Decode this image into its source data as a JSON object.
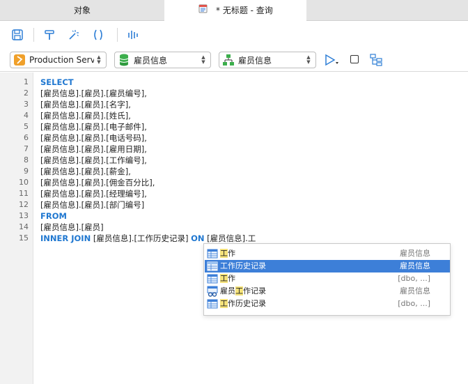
{
  "tabs": {
    "objects": "对象",
    "query": "* 无标题 - 查询"
  },
  "connection": {
    "server": "Production Server",
    "database": "雇员信息",
    "schema": "雇员信息"
  },
  "editor": {
    "line_numbers": [
      "1",
      "2",
      "3",
      "4",
      "5",
      "6",
      "7",
      "8",
      "9",
      "10",
      "11",
      "12",
      "13",
      "14",
      "15"
    ],
    "lines": {
      "l1_kw": "SELECT",
      "l2": "[雇员信息].[雇员].[雇员编号],",
      "l3": "[雇员信息].[雇员].[名字],",
      "l4": "[雇员信息].[雇员].[姓氏],",
      "l5": "[雇员信息].[雇员].[电子邮件],",
      "l6": "[雇员信息].[雇员].[电话号码],",
      "l7": "[雇员信息].[雇员].[雇用日期],",
      "l8": "[雇员信息].[雇员].[工作编号],",
      "l9": "[雇员信息].[雇员].[薪金],",
      "l10": "[雇员信息].[雇员].[佣金百分比],",
      "l11": "[雇员信息].[雇员].[经理编号],",
      "l12": "[雇员信息].[雇员].[部门编号]",
      "l13_kw": "FROM",
      "l14": "[雇员信息].[雇员]",
      "l15_kw1": "INNER JOIN",
      "l15_t1": " [雇员信息].[工作历史记录] ",
      "l15_kw2": "ON",
      "l15_t2": " [雇员信息].工"
    }
  },
  "autocomplete": {
    "items": [
      {
        "pre": "",
        "hl": "工",
        "post": "作",
        "schema": "雇员信息",
        "icon": "table-icon"
      },
      {
        "pre": "",
        "hl": "工",
        "post": "作历史记录",
        "schema": "雇员信息",
        "icon": "table-icon",
        "selected": true
      },
      {
        "pre": "",
        "hl": "工",
        "post": "作",
        "schema": "[dbo, ...]",
        "icon": "table-icon"
      },
      {
        "pre": "雇员",
        "hl": "工",
        "post": "作记录",
        "schema": "雇员信息",
        "icon": "view-icon"
      },
      {
        "pre": "",
        "hl": "工",
        "post": "作历史记录",
        "schema": "[dbo, ...]",
        "icon": "table-icon"
      }
    ]
  },
  "colors": {
    "keyword": "#1f77d0",
    "selection": "#3d7fd8",
    "match_highlight": "#f5e27a",
    "icon_accent": "#2f7fd6"
  }
}
